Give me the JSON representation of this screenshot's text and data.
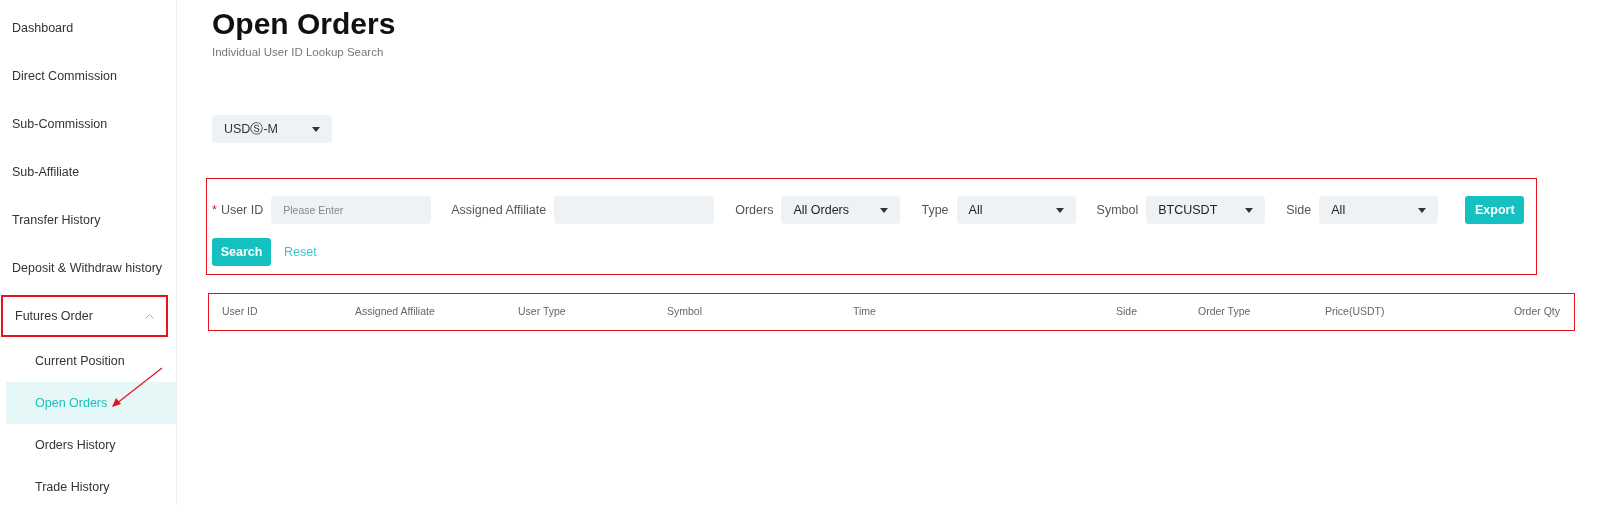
{
  "sidebar": {
    "items": [
      {
        "label": "Dashboard",
        "selected": false
      },
      {
        "label": "Direct Commission",
        "selected": false
      },
      {
        "label": "Sub-Commission",
        "selected": false
      },
      {
        "label": "Sub-Affiliate",
        "selected": false
      },
      {
        "label": "Transfer History",
        "selected": false
      },
      {
        "label": "Deposit & Withdraw history",
        "selected": false
      },
      {
        "label": "Futures Order",
        "selected": false,
        "expanded": true,
        "children": [
          {
            "label": "Current Position",
            "selected": false
          },
          {
            "label": "Open Orders",
            "selected": true
          },
          {
            "label": "Orders History",
            "selected": false
          },
          {
            "label": "Trade History",
            "selected": false
          }
        ]
      }
    ]
  },
  "page": {
    "title": "Open Orders",
    "subtitle": "Individual User ID Lookup Search"
  },
  "market_select": {
    "value": "USDⓈ-M"
  },
  "filters": [
    {
      "kind": "input",
      "required_mark": "*",
      "label": "User ID",
      "placeholder": "Please Enter"
    },
    {
      "kind": "input",
      "label": "Assigned Affiliate"
    },
    {
      "kind": "select",
      "label": "Orders",
      "value": "All Orders"
    },
    {
      "kind": "select",
      "label": "Type",
      "value": "All"
    },
    {
      "kind": "select",
      "label": "Symbol",
      "value": "BTCUSDT"
    },
    {
      "kind": "select",
      "label": "Side",
      "value": "All"
    }
  ],
  "buttons": {
    "export": "Export",
    "search": "Search",
    "reset": "Reset"
  },
  "table": {
    "columns": [
      "User ID",
      "Assigned Affiliate",
      "User Type",
      "Symbol",
      "Time",
      "Side",
      "Order Type",
      "Price(USDT)",
      "Order Qty"
    ]
  }
}
